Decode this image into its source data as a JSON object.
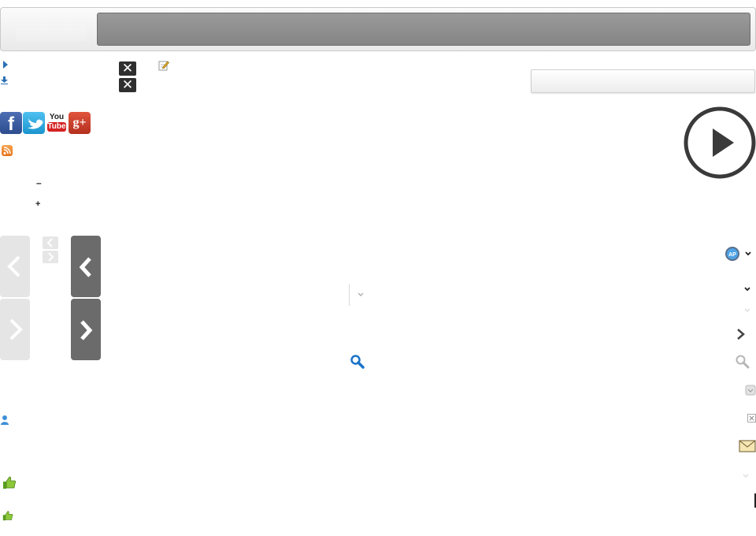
{
  "header": {
    "title": ""
  },
  "social": {
    "facebook_letter": "f",
    "youtube_you": "You",
    "youtube_tube": "Tube",
    "googleplus_label": "g+"
  },
  "controls": {
    "collapse_symbol": "–",
    "expand_symbol": "+"
  },
  "icons": [
    "play-arrow-icon",
    "download-icon",
    "close-icon",
    "edit-icon",
    "facebook-icon",
    "twitter-icon",
    "youtube-icon",
    "google-plus-icon",
    "rss-icon",
    "minus-icon",
    "plus-icon",
    "chevron-left-icon",
    "chevron-right-icon",
    "play-circle-icon",
    "app-badge-icon",
    "chevron-down-icon",
    "search-icon",
    "user-icon",
    "thumbs-up-icon",
    "envelope-icon",
    "checkbox-icon",
    "close-box-icon"
  ],
  "colors": {
    "header_bar": "#8f8f8f",
    "close_button": "#2f2f2f",
    "dark_arrow": "#6b6b6b",
    "light_arrow": "#e5e5e5",
    "link_blue": "#2a6fb5"
  }
}
